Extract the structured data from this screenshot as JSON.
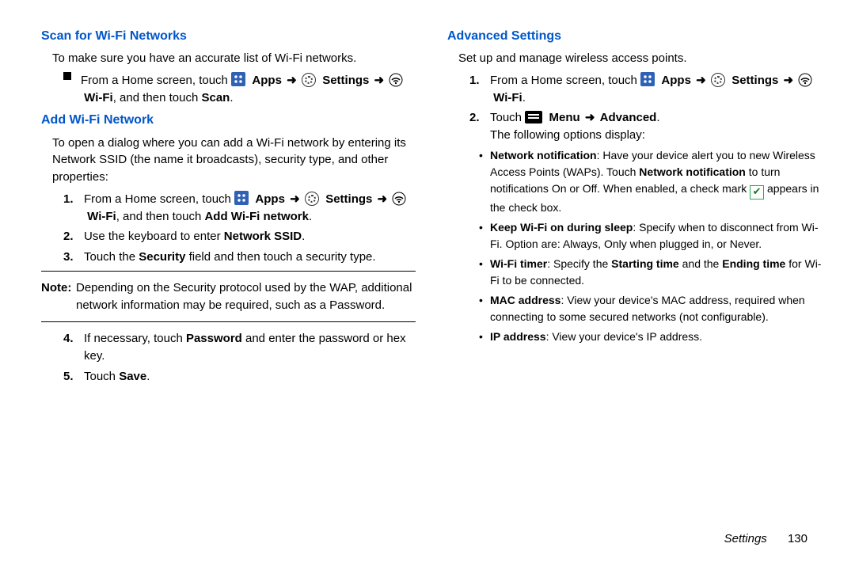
{
  "left": {
    "h1": "Scan for Wi-Fi Networks",
    "p1": "To make sure you have an accurate list of Wi-Fi networks.",
    "bullet1a": "From a Home screen, touch ",
    "apps_label": "Apps",
    "settings_label": "Settings",
    "wifi_label": "Wi-Fi",
    "bullet1b": ", and then touch ",
    "scan": "Scan",
    "h2": "Add Wi-Fi Network",
    "p2": "To open a dialog where you can add a Wi-Fi network by entering its Network SSID (the name it broadcasts), security type, and other properties:",
    "step1a": "From a Home screen, touch ",
    "step1b": ", and then touch ",
    "addnet": "Add Wi-Fi network",
    "step2a": "Use the keyboard to enter ",
    "ssid": "Network SSID",
    "step3a": "Touch the ",
    "security": "Security",
    "step3b": " field and then touch a security type.",
    "note_label": "Note:",
    "note_text": "Depending on the Security protocol used by the WAP, additional network information may be required, such as a Password.",
    "step4a": "If necessary, touch ",
    "password": "Password",
    "step4b": " and enter the password or hex key.",
    "step5a": "Touch ",
    "save": "Save"
  },
  "right": {
    "h1": "Advanced Settings",
    "p1": "Set up and manage wireless access points.",
    "step1a": "From a Home screen, touch ",
    "step2a": "Touch ",
    "menu": "Menu",
    "advanced": "Advanced",
    "following": "The following options display:",
    "b1_bold": "Network notification",
    "b1a": ": Have your device alert you to new Wireless Access Points (WAPs). Touch ",
    "b1_bold2": "Network notification",
    "b1b": " to turn notifications On or Off. When enabled, a check mark ",
    "b1c": " appears in the check box.",
    "b2_bold": "Keep Wi-Fi on during sleep",
    "b2a": ": Specify when to disconnect from Wi-Fi. Option are: Always, Only when plugged in, or Never.",
    "b3_bold": "Wi-Fi timer",
    "b3a": ": Specify the ",
    "b3_bold2": "Starting time",
    "b3b": " and the ",
    "b3_bold3": "Ending time",
    "b3c": " for Wi-Fi to be connected.",
    "b4_bold": "MAC address",
    "b4a": ": View your device's MAC address, required when connecting to some secured networks (not configurable).",
    "b5_bold": "IP address",
    "b5a": ": View your device's IP address."
  },
  "footer": {
    "section": "Settings",
    "page": "130"
  },
  "markers": {
    "n1": "1.",
    "n2": "2.",
    "n3": "3.",
    "n4": "4.",
    "n5": "5.",
    "arrow": "➜",
    "dot": "•",
    "period": "."
  }
}
